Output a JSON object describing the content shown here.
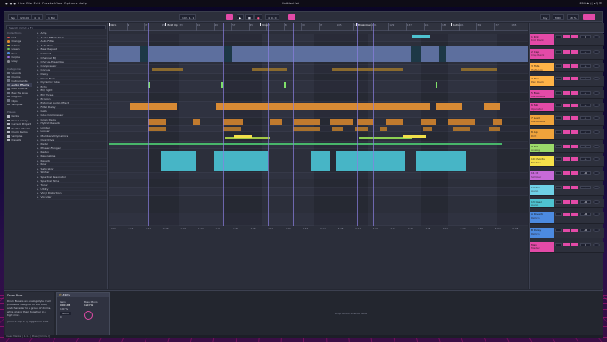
{
  "menubar": {
    "left": "● ● ●  Live  File  Edit  Create  View  Options  Help",
    "title": "Untitled Set",
    "right": "85%  ✱  (( •  Q  ☰"
  },
  "transport": {
    "tempo": "120.00",
    "meter": "4 / 4",
    "quant": "1 Bar",
    "position": "193. 1. 1",
    "loop": "4. 0. 0",
    "key": "Key",
    "midi": "MIDI",
    "cpu": "18 %"
  },
  "browser": {
    "search_placeholder": "Search (Cmd + F)",
    "collections_label": "Collections",
    "collections": [
      {
        "label": "Red",
        "color": "#e5524f"
      },
      {
        "label": "Orange",
        "color": "#e08a2f"
      },
      {
        "label": "Yellow",
        "color": "#e2c93a"
      },
      {
        "label": "Green",
        "color": "#64c25b"
      },
      {
        "label": "Blue",
        "color": "#4c8ae0"
      },
      {
        "label": "Purple",
        "color": "#9a6ae0"
      },
      {
        "label": "Gray",
        "color": "#8a8a95"
      }
    ],
    "categories_label": "Categories",
    "categories": [
      "Sounds",
      "Drums",
      "Instruments",
      "Audio Effects",
      "MIDI Effects",
      "Max for Live",
      "Plug-Ins",
      "Clips",
      "Samples"
    ],
    "places_label": "Places",
    "places": [
      "Packs",
      "User Library",
      "Current Project",
      "Studio Albums",
      "Drum Racks",
      "Samples",
      "Presets"
    ],
    "items": [
      "Amp",
      "Audio Effect Rack",
      "Auto Filter",
      "Auto Pan",
      "Beat Repeat",
      "Cabinet",
      "Channel EQ",
      "Chorus-Ensemble",
      "Compressor",
      "Corpus",
      "Delay",
      "Drum Buss",
      "Dynamic Tube",
      "Echo",
      "EQ Eight",
      "EQ Three",
      "Erosion",
      "External Audio Effect",
      "Filter Delay",
      "Gate",
      "Glue Compressor",
      "Grain Delay",
      "Hybrid Reverb",
      "Limiter",
      "Looper",
      "Multiband Dynamics",
      "Overdrive",
      "Pedal",
      "Phaser-Flanger",
      "Redux",
      "Resonators",
      "Reverb",
      "Roar",
      "Saturator",
      "Shifter",
      "Spectral Resonator",
      "Spectral Time",
      "Tuner",
      "Utility",
      "Vinyl Distortion",
      "Vocoder"
    ]
  },
  "arrangement": {
    "bars": [
      "1",
      "9",
      "17",
      "25",
      "33",
      "41",
      "49",
      "57",
      "65",
      "73",
      "81",
      "89",
      "97",
      "105",
      "113",
      "121",
      "129",
      "137",
      "145",
      "153",
      "161",
      "169",
      "177",
      "185",
      "193"
    ],
    "locators": [
      {
        "label": "Intro",
        "pos": 0.0
      },
      {
        "label": "Build Up",
        "pos": 0.135
      },
      {
        "label": "Drop",
        "pos": 0.36
      },
      {
        "label": "Breakdown",
        "pos": 0.59
      },
      {
        "label": "Outro",
        "pos": 0.815
      }
    ],
    "time_labels": [
      "0:00",
      "0:16",
      "0:32",
      "0:48",
      "1:04",
      "1:20",
      "1:36",
      "1:52",
      "2:08",
      "2:24",
      "2:40",
      "2:56",
      "3:12",
      "3:28",
      "3:44",
      "4:00",
      "4:16",
      "4:32",
      "4:48",
      "5:04",
      "5:20",
      "5:36",
      "5:52",
      "6:08"
    ]
  },
  "tracks": [
    {
      "name": "1 Kick",
      "sub": "Kick Rack",
      "color": "#e34aa7",
      "vol": "0"
    },
    {
      "name": "2 Clap",
      "sub": "Clap Rack",
      "color": "#e34aa7",
      "vol": "-3"
    },
    {
      "name": "3 Hats",
      "sub": "Hat Loop",
      "color": "#ffb347",
      "vol": "-6"
    },
    {
      "name": "4 Perc",
      "sub": "Perc Rack",
      "color": "#ffb347",
      "vol": "-8"
    },
    {
      "name": "5 Bass",
      "sub": "Wavetable",
      "color": "#e34aa7",
      "vol": "-2"
    },
    {
      "name": "6 Sub",
      "sub": "Operator",
      "color": "#e34aa7",
      "vol": "-4"
    },
    {
      "name": "7 Lead",
      "sub": "Wavetable",
      "color": "#f0a33b",
      "vol": "-5"
    },
    {
      "name": "8 Arp",
      "sub": "Drift",
      "color": "#f0a33b",
      "vol": "-7"
    },
    {
      "name": "9 Pad",
      "sub": "Analog",
      "color": "#9bd96a",
      "vol": "-9"
    },
    {
      "name": "10 Chords",
      "sub": "Electric",
      "color": "#f5e04a",
      "vol": "-6"
    },
    {
      "name": "11 FX",
      "sub": "Simpler",
      "color": "#c76ad9",
      "vol": "-10"
    },
    {
      "name": "12 Vox",
      "sub": "Audio",
      "color": "#6fd0e6",
      "vol": "-4"
    },
    {
      "name": "13 Riser",
      "sub": "Audio",
      "color": "#4ec2d0",
      "vol": "-12"
    },
    {
      "name": "A Reverb",
      "sub": "Return",
      "color": "#4c8ae0",
      "vol": "-14"
    },
    {
      "name": "B Delay",
      "sub": "Return",
      "color": "#4c8ae0",
      "vol": "-16"
    },
    {
      "name": "Main",
      "sub": "Master",
      "color": "#e34aa7",
      "vol": "0"
    }
  ],
  "info": {
    "title": "Drum Buss",
    "text": "Drum Buss is an analog-style drum processor designed to add body and character to a group of drums, while gluing them together in a tight mix.",
    "shortcuts": "[Cmd + Opt + I] Toggle Info View"
  },
  "device": {
    "name": "Utility",
    "gain": "0.00 dB",
    "width": "100 %",
    "mono": "Mono",
    "balance": "C",
    "bass_mono": "Bass Mono",
    "freq": "120 Hz"
  },
  "dropzone_text": "Drop Audio Effects Here",
  "status_text": "Insert Marker  |  1.1.1  |  Press [Cmd + I]"
}
